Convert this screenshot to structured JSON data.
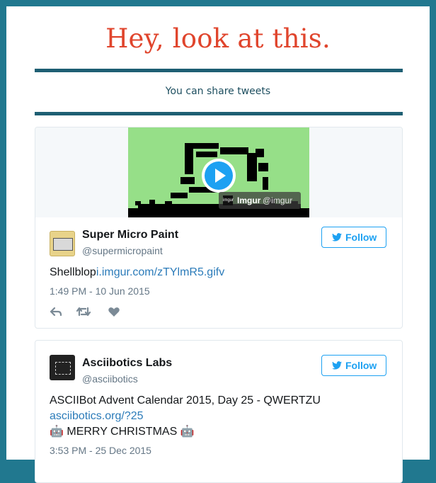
{
  "header": {
    "title": "Hey, look at this.",
    "subtitle": "You can share tweets"
  },
  "tweets": [
    {
      "name": "Super Micro Paint",
      "handle": "@supermicropaint",
      "text": "Shellblop",
      "link": "i.imgur.com/zTYlmR5.gifv",
      "time": "1:49 PM - 10 Jun 2015",
      "follow_label": "Follow",
      "media": {
        "logo_text": "imgur",
        "source_name": "Imgur",
        "source_handle": "@imgur"
      }
    },
    {
      "name": "Asciibotics Labs",
      "handle": "@asciibotics",
      "text": "ASCIIBot Advent Calendar 2015, Day 25 - QWERTZU",
      "link": "asciibotics.org/?25",
      "text2": "🤖 MERRY CHRISTMAS 🤖",
      "time": "3:53 PM - 25 Dec 2015",
      "follow_label": "Follow"
    }
  ],
  "colors": {
    "accent": "#e0452d",
    "frame": "#21788f",
    "rule": "#1e5f73",
    "twitter_blue": "#1da1f2"
  }
}
